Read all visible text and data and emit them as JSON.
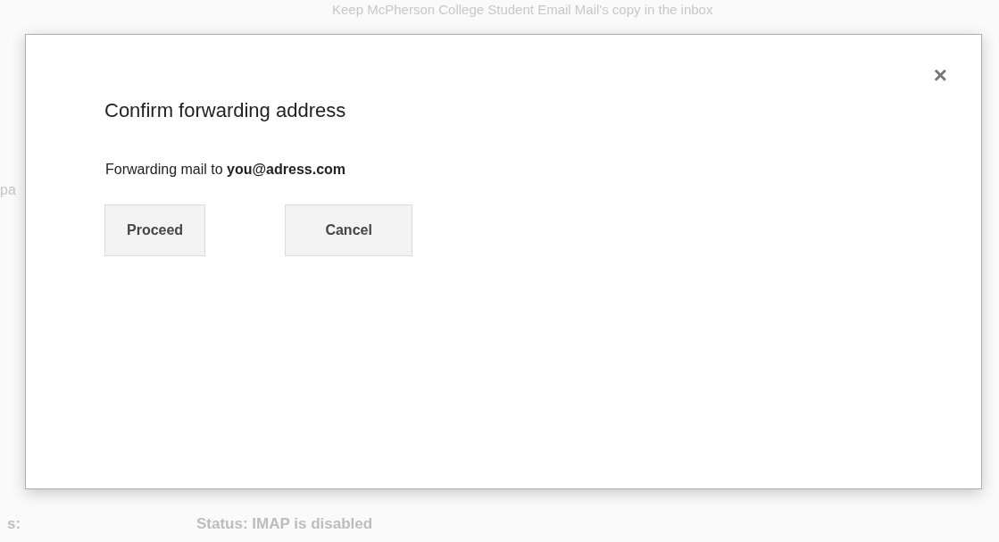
{
  "background": {
    "top_option": "Keep McPherson College Student Email Mail's copy in the inbox",
    "side_fragment": "pa",
    "imap_label": "s:",
    "imap_status": "Status: IMAP is disabled"
  },
  "dialog": {
    "title": "Confirm forwarding address",
    "close": "×",
    "message": "Forwarding mail to **you@adress.com**",
    "buttons": [
      {
        "label": "Proceed"
      },
      {
        "label": "Cancel"
      }
    ]
  }
}
